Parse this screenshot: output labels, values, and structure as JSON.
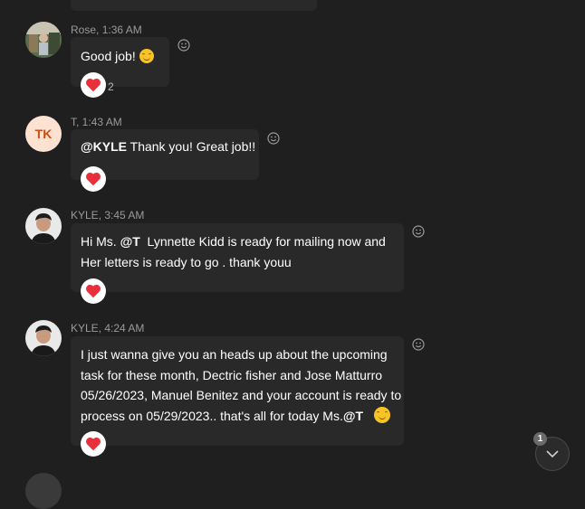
{
  "messages": [
    {
      "author": "Rose",
      "time": "1:36 AM",
      "text": "Good job!",
      "emoji": "smiling-face",
      "reaction": {
        "icon": "heart",
        "count": "2"
      }
    },
    {
      "author": "T",
      "time": "1:43 AM",
      "avatar_initials": "TK",
      "mention": "@KYLE",
      "text": " Thank you! Great job!!",
      "reaction": {
        "icon": "heart"
      }
    },
    {
      "author": "KYLE",
      "time": "3:45 AM",
      "lines": [
        "Lynnette Kidd is ready for mailing now and",
        "Her letters is ready to go . thank youu"
      ],
      "prefix": "Hi Ms. ",
      "mention": "@T",
      "reaction": {
        "icon": "heart"
      }
    },
    {
      "author": "KYLE",
      "time": "4:24 AM",
      "lines": [
        "I just wanna give you an heads up about the upcoming",
        "task for these month, Dectric fisher and Jose Matturro",
        "05/26/2023, Manuel Benitez and your account is ready to",
        "process on 05/29/2023.. that's all for today Ms."
      ],
      "mention": "@T",
      "emoji": "smiling-face",
      "reaction": {
        "icon": "heart"
      }
    }
  ],
  "scroll_down": {
    "badge": "1",
    "icon": "chevron-down-icon"
  },
  "colors": {
    "background": "#1f1f1f",
    "bubble": "#292929",
    "meta": "#9a9a9a",
    "heart": "#e8303d"
  }
}
